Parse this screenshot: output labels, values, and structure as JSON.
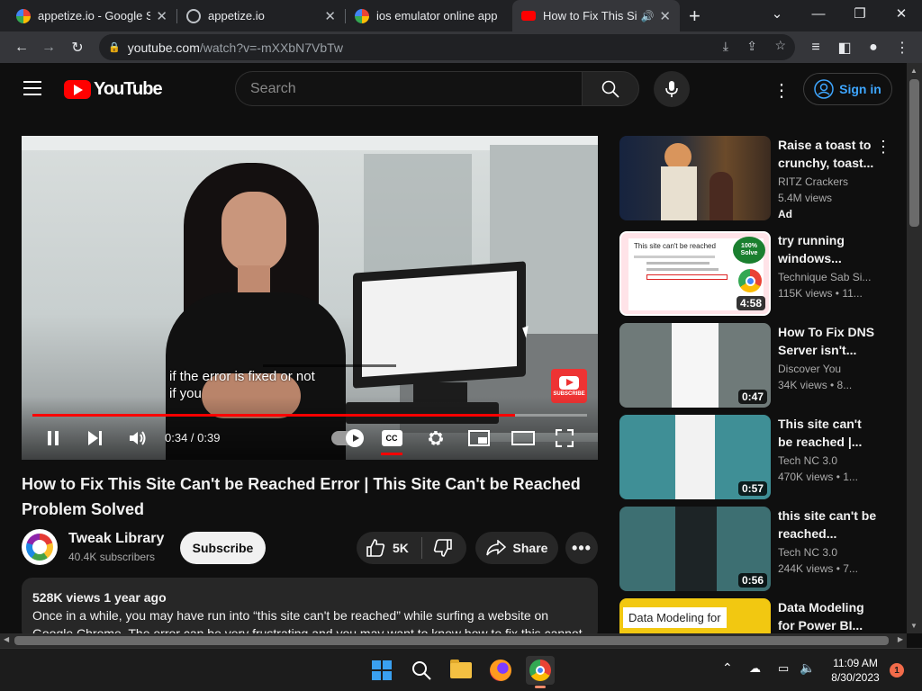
{
  "browser": {
    "tabs": [
      {
        "title": "appetize.io - Google Se",
        "favicon": "google-icon"
      },
      {
        "title": "appetize.io",
        "favicon": "globe-icon"
      },
      {
        "title": "ios emulator online app",
        "favicon": "google-icon"
      },
      {
        "title": "How to Fix This Site",
        "favicon": "youtube-icon",
        "active": true
      }
    ],
    "url_host": "youtube.com",
    "url_path": "/watch?v=-mXXbN7VbTw"
  },
  "header": {
    "logo_text": "YouTube",
    "search_placeholder": "Search",
    "signin_label": "Sign in"
  },
  "player": {
    "caption_line1": "if the error is fixed or not",
    "caption_line2": "if you",
    "subscribe_watermark": "SUBSCRIBE",
    "time": "0:34 / 0:39",
    "progress": 0.87,
    "cc_label": "CC"
  },
  "video": {
    "title": "How to Fix This Site Can't be Reached Error | This Site Can't be Reached Problem Solved",
    "channel": "Tweak Library",
    "subscribers": "40.4K subscribers",
    "subscribe_label": "Subscribe",
    "likes": "5K",
    "share_label": "Share",
    "views_age": "528K views  1 year ago",
    "description": "Once in a while, you may have run into “this site can't be reached” while surfing a website on Google Chrome. The error can be very frustrating and you may want to know how to fix this cannot be"
  },
  "recommendations": [
    {
      "title": "Raise a toast to crunchy, toast...",
      "channel": "RITZ Crackers",
      "meta": "5.4M views",
      "badge": "Ad",
      "duration": ""
    },
    {
      "title": "try running windows...",
      "channel": "Technique Sab Si...",
      "meta": "115K views • 11...",
      "duration": "4:58",
      "thumb_text": "This site can't be reached",
      "thumb_badge": "100% Solve"
    },
    {
      "title": "How To Fix DNS Server isn't...",
      "channel": "Discover You",
      "meta": "34K views • 8...",
      "duration": "0:47"
    },
    {
      "title": "This site can't be reached |...",
      "channel": "Tech NC 3.0",
      "meta": "470K views • 1...",
      "duration": "0:57"
    },
    {
      "title": "this site can't be reached...",
      "channel": "Tech NC 3.0",
      "meta": "244K views • 7...",
      "duration": "0:56"
    },
    {
      "title": "Data Modeling for Power BI...",
      "channel": "",
      "meta": "",
      "duration": "",
      "thumb_text": "Data Modeling for"
    }
  ],
  "taskbar": {
    "time": "11:09 AM",
    "date": "8/30/2023",
    "notification_count": "1"
  },
  "colors": {
    "accent_red": "#ff0000",
    "link_blue": "#3ea6ff",
    "bg": "#0f0f0f"
  }
}
